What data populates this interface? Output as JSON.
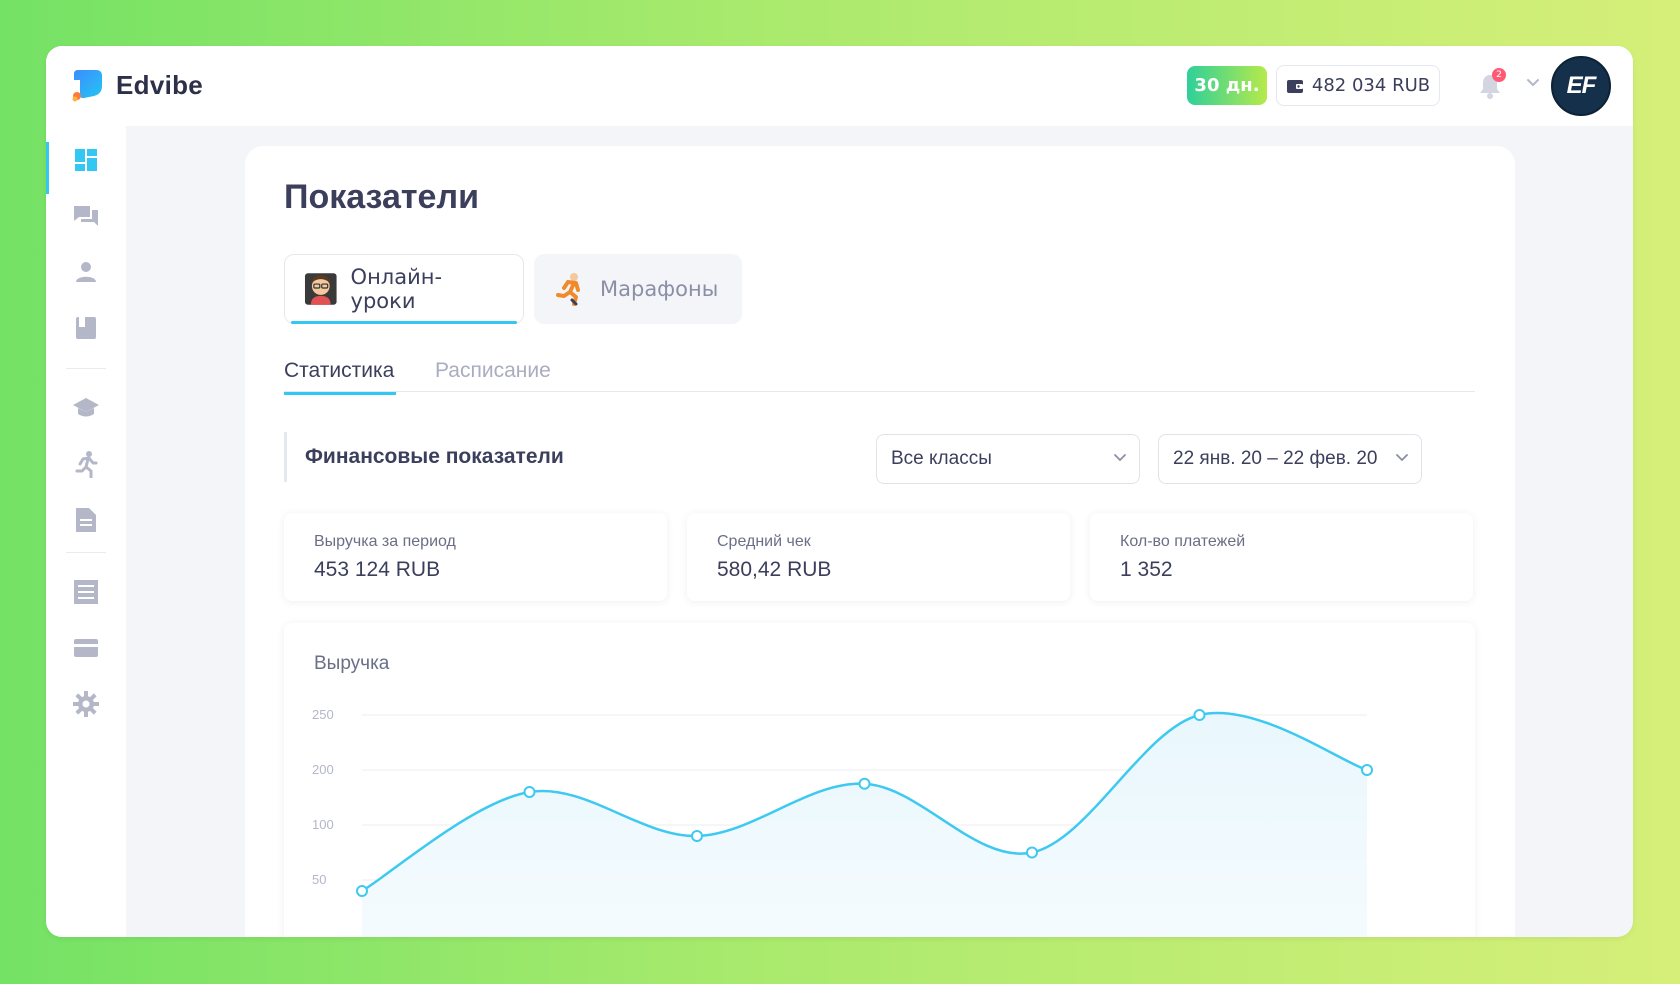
{
  "app": {
    "name": "Edvibe"
  },
  "topbar": {
    "days_badge": "30 дн.",
    "balance": "482 034 RUB",
    "notifications_count": "2",
    "avatar_text": "EF"
  },
  "sidebar": {
    "items": [
      {
        "icon": "dashboard-icon",
        "active": true
      },
      {
        "icon": "chat-icon"
      },
      {
        "icon": "user-icon"
      },
      {
        "icon": "book-icon"
      },
      {
        "icon": "graduation-cap-icon"
      },
      {
        "icon": "running-man-icon"
      },
      {
        "icon": "document-icon"
      },
      {
        "icon": "receipt-icon"
      },
      {
        "icon": "credit-card-icon"
      },
      {
        "icon": "gear-icon"
      }
    ]
  },
  "page": {
    "title": "Показатели",
    "mode_tabs": [
      {
        "label": "Онлайн-уроки",
        "icon": "teacher-emoji",
        "active": true
      },
      {
        "label": "Марафоны",
        "icon": "runner-emoji",
        "active": false
      }
    ],
    "sub_tabs": [
      {
        "label": "Статистика",
        "active": true
      },
      {
        "label": "Расписание",
        "active": false
      }
    ],
    "section_title": "Финансовые показатели",
    "filters": {
      "class_select": "Все классы",
      "date_range": "22 янв. 20 – 22 фев. 20"
    },
    "stats": [
      {
        "label": "Выручка за период",
        "value": "453 124 RUB"
      },
      {
        "label": "Средний чек",
        "value": "580,42 RUB"
      },
      {
        "label": "Кол-во платежей",
        "value": "1 352"
      }
    ]
  },
  "chart_data": {
    "type": "line",
    "title": "Выручка",
    "y_ticks": [
      "250",
      "200",
      "100",
      "50"
    ],
    "values": [
      40,
      160,
      90,
      175,
      75,
      250,
      200
    ],
    "series_color": "#3ec9f0",
    "grid": true
  }
}
